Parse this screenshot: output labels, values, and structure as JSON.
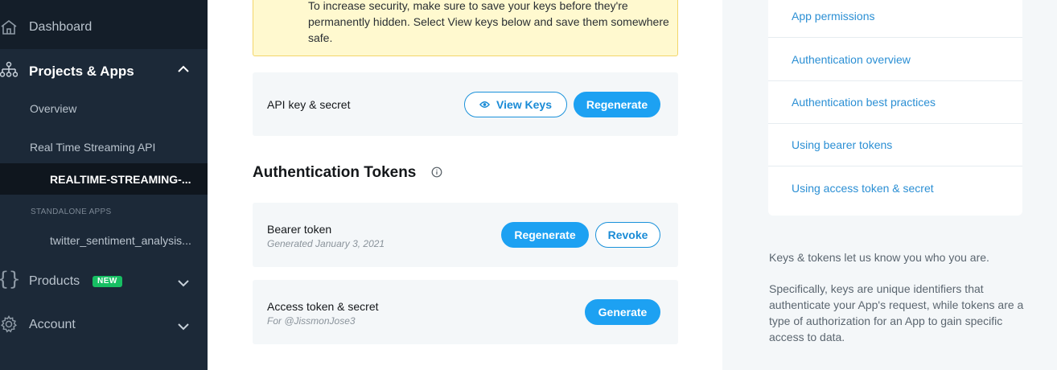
{
  "sidebar": {
    "dashboard": "Dashboard",
    "projects_apps": "Projects & Apps",
    "overview": "Overview",
    "project_name": "Real Time Streaming API",
    "active_app": "REALTIME-STREAMING-...",
    "standalone_caption": "STANDALONE APPS",
    "standalone_app": "twitter_sentiment_analysis...",
    "products": "Products",
    "products_badge": "NEW",
    "account": "Account",
    "icons": [
      "home-icon",
      "project-tree-icon",
      "braces-icon",
      "gear-icon"
    ]
  },
  "notice": {
    "text": "To increase security, make sure to save your keys before they're permanently hidden. Select View keys below and save them somewhere safe."
  },
  "api_keys": {
    "label": "API key & secret",
    "view_keys": "View Keys",
    "regenerate": "Regenerate"
  },
  "auth_tokens": {
    "title": "Authentication Tokens",
    "bearer": {
      "label": "Bearer token",
      "sub": "Generated January 3, 2021",
      "regenerate": "Regenerate",
      "revoke": "Revoke"
    },
    "access": {
      "label": "Access token & secret",
      "sub": "For @JissmonJose3",
      "generate": "Generate"
    }
  },
  "right_links": [
    "App permissions",
    "Authentication overview",
    "Authentication best practices",
    "Using bearer tokens",
    "Using access token & secret"
  ],
  "right_desc": {
    "p1": "Keys & tokens let us know you who you are.",
    "p2": "Specifically, keys are unique identifiers that authenticate your App's request, while tokens are a type of authorization for an App to gain specific access to data."
  },
  "colors": {
    "sidebar_bg": "#1c2938",
    "accent": "#1da1f2",
    "notice_bg": "#fff9cf",
    "badge_green": "#17bf63"
  }
}
